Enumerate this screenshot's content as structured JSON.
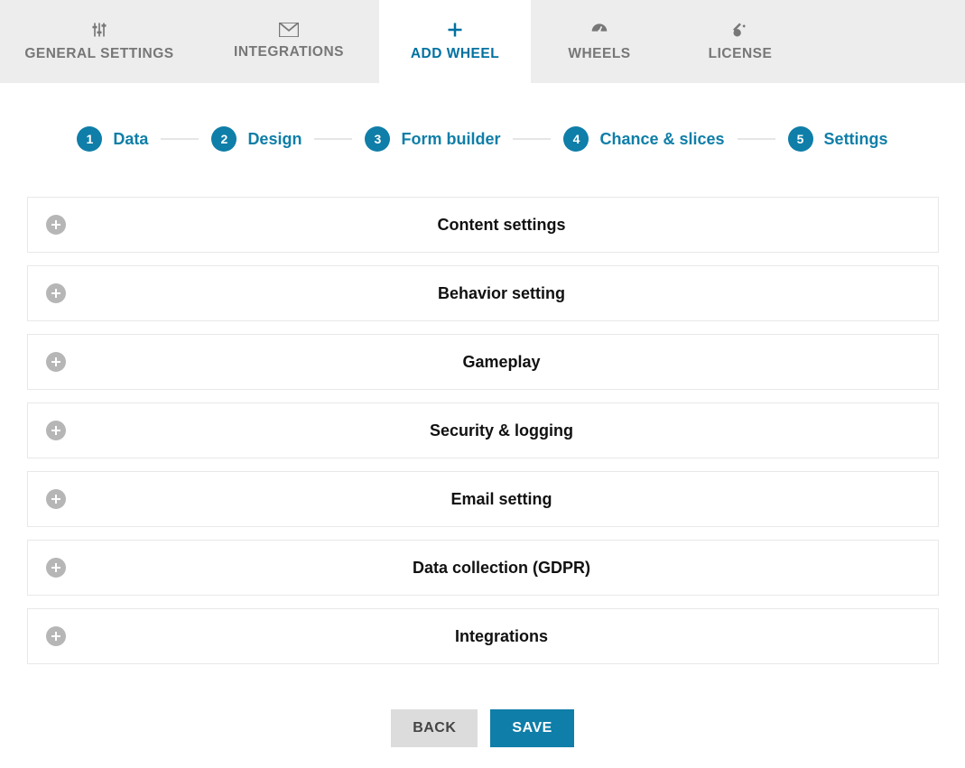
{
  "topTabs": [
    {
      "id": "general-settings",
      "label": "GENERAL SETTINGS",
      "icon": "sliders",
      "active": false
    },
    {
      "id": "integrations",
      "label": "INTEGRATIONS",
      "icon": "mail",
      "active": false
    },
    {
      "id": "add-wheel",
      "label": "ADD WHEEL",
      "icon": "plus",
      "active": true
    },
    {
      "id": "wheels",
      "label": "WHEELS",
      "icon": "gauge",
      "active": false
    },
    {
      "id": "license",
      "label": "LICENSE",
      "icon": "key",
      "active": false
    }
  ],
  "steps": [
    {
      "num": "1",
      "label": "Data"
    },
    {
      "num": "2",
      "label": "Design"
    },
    {
      "num": "3",
      "label": "Form builder"
    },
    {
      "num": "4",
      "label": "Chance & slices"
    },
    {
      "num": "5",
      "label": "Settings"
    }
  ],
  "panels": [
    {
      "title": "Content settings"
    },
    {
      "title": "Behavior setting"
    },
    {
      "title": "Gameplay"
    },
    {
      "title": "Security & logging"
    },
    {
      "title": "Email setting"
    },
    {
      "title": "Data collection (GDPR)"
    },
    {
      "title": "Integrations"
    }
  ],
  "buttons": {
    "back": "BACK",
    "save": "SAVE"
  },
  "colors": {
    "accent": "#0f7ea8",
    "tabActive": "#0071a1",
    "panelBorder": "#e8e8e8",
    "grey": "#b6b6b6"
  }
}
